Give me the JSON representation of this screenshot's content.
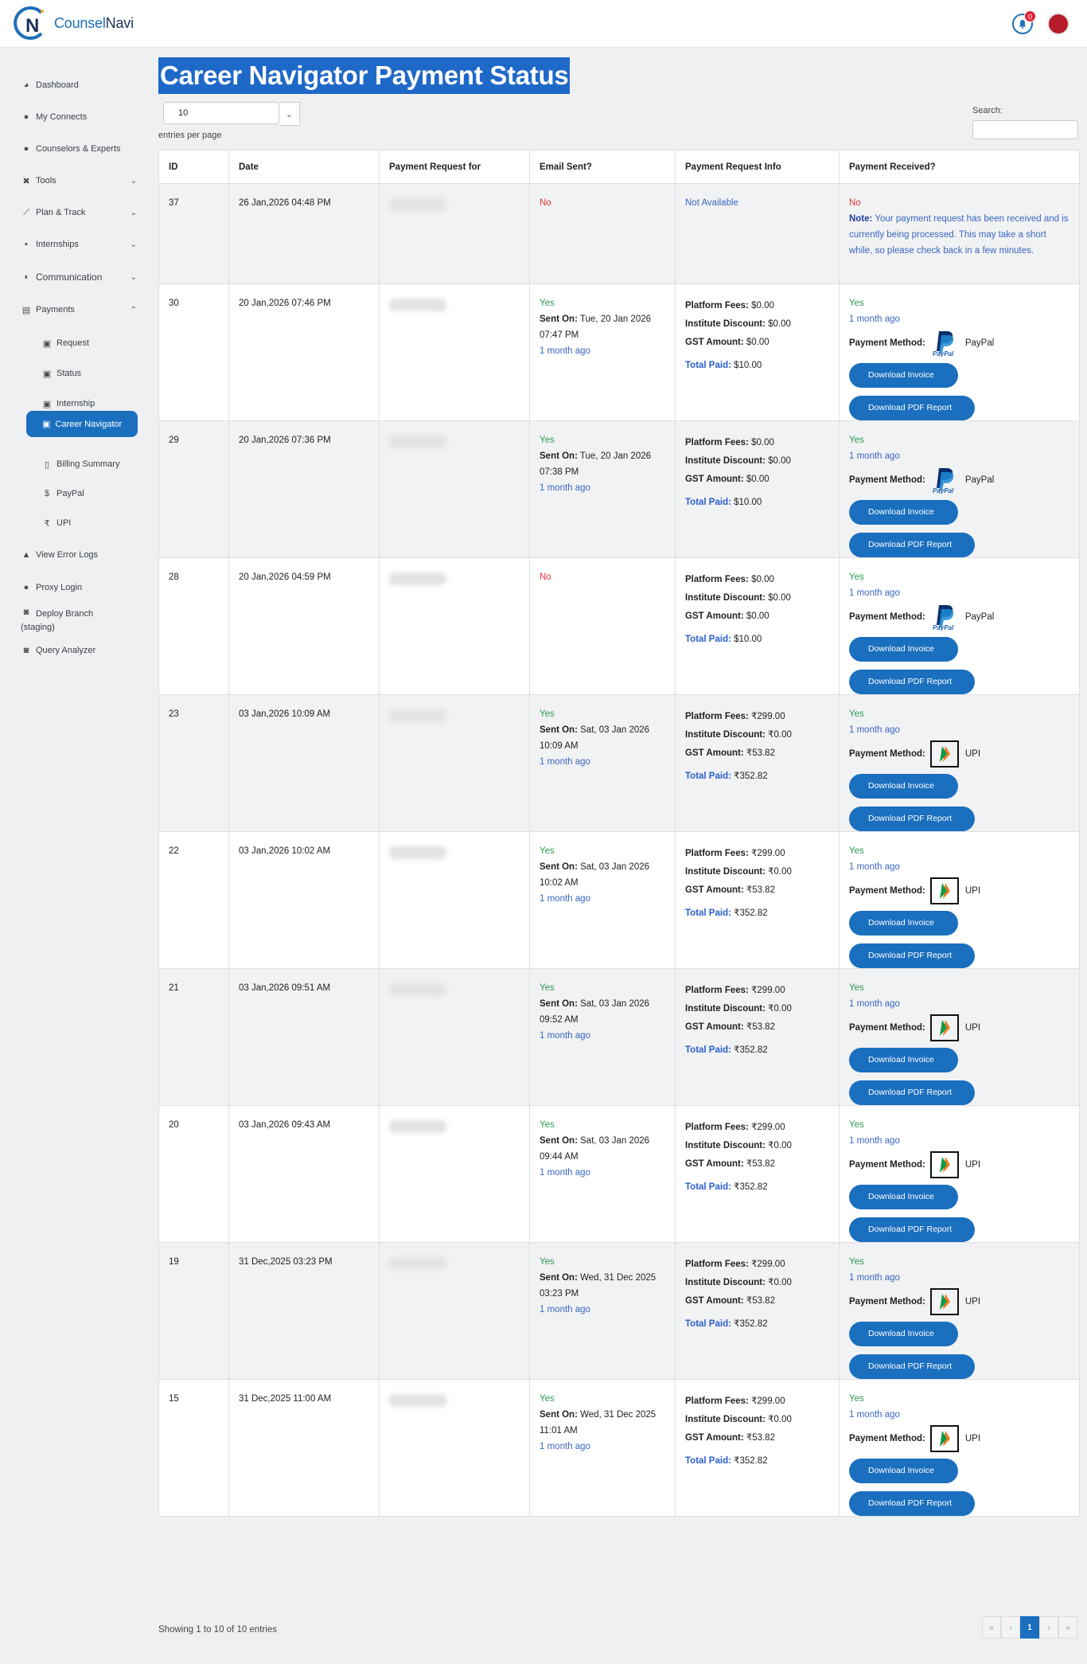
{
  "header": {
    "brand_part1": "Counsel",
    "brand_part2": "Navi",
    "notification_count": "0"
  },
  "sidebar": {
    "items": [
      {
        "label": "Dashboard",
        "icon": "dashboard-icon"
      },
      {
        "label": "My Connects",
        "icon": "user-icon"
      },
      {
        "label": "Counselors & Experts",
        "icon": "user-icon"
      },
      {
        "label": "Tools",
        "icon": "tools-icon"
      },
      {
        "label": "Plan & Track",
        "icon": "chart-icon"
      },
      {
        "label": "Internships",
        "icon": "briefcase-icon"
      },
      {
        "label": "Communication",
        "icon": "chat-icon"
      },
      {
        "label": "Payments",
        "icon": "wallet-icon"
      },
      {
        "label": "Request",
        "icon": "money-icon"
      },
      {
        "label": "Status",
        "icon": "money-icon"
      },
      {
        "label": "Internship",
        "icon": "money-icon"
      },
      {
        "label": "Career Navigator",
        "icon": "money-icon"
      },
      {
        "label": "Billing Summary",
        "icon": "document-icon"
      },
      {
        "label": "PayPal",
        "icon": "dollar-icon"
      },
      {
        "label": "UPI",
        "icon": "rupee-icon"
      },
      {
        "label": "View Error Logs",
        "icon": "warning-icon"
      },
      {
        "label": "Proxy Login",
        "icon": "user-icon"
      },
      {
        "label": "Deploy Branch",
        "sublabel": "(staging)",
        "icon": "database-icon"
      },
      {
        "label": "Query Analyzer",
        "icon": "database-icon"
      }
    ]
  },
  "page": {
    "title": "Career Navigator Payment Status",
    "page_length": "10",
    "entries_per_page": "entries per page",
    "search_label": "Search:",
    "search_placeholder": "",
    "showing": "Showing 1 to 10 of 10 entries",
    "pager": {
      "first": "«",
      "prev": "‹",
      "current": "1",
      "next": "›",
      "last": "»"
    }
  },
  "table": {
    "columns": [
      "ID",
      "Date",
      "Payment Request for",
      "Email Sent?",
      "Payment Request Info",
      "Payment Received?"
    ],
    "labels": {
      "sent_on": "Sent On:",
      "platform_fees": "Platform Fees:",
      "institute_discount": "Institute Discount:",
      "gst_amount": "GST Amount:",
      "total_paid": "Total Paid:",
      "payment_method": "Payment Method:",
      "download_invoice": "Download Invoice",
      "download_pdf": "Download PDF Report",
      "note_label": "Note:"
    },
    "rows": [
      {
        "id": "37",
        "date": "26 Jan,2026 04:48 PM",
        "email": "No",
        "info_na": "Not Available",
        "received": "No",
        "note": "Your payment request has been received and is currently being processed. This may take a short while, so please check back in a few minutes."
      },
      {
        "id": "30",
        "date": "20 Jan,2026 07:46 PM",
        "email": "Yes",
        "sent_on": "Tue, 20 Jan 2026 07:47 PM",
        "ago": "1 month ago",
        "platform_fees": "$0.00",
        "institute_discount": "$0.00",
        "gst": "$0.00",
        "total": "$10.00",
        "received": "Yes",
        "received_ago": "1 month ago",
        "method": "PayPal",
        "method_icon": "paypal-icon"
      },
      {
        "id": "29",
        "date": "20 Jan,2026 07:36 PM",
        "email": "Yes",
        "sent_on": "Tue, 20 Jan 2026 07:38 PM",
        "ago": "1 month ago",
        "platform_fees": "$0.00",
        "institute_discount": "$0.00",
        "gst": "$0.00",
        "total": "$10.00",
        "received": "Yes",
        "received_ago": "1 month ago",
        "method": "PayPal",
        "method_icon": "paypal-icon"
      },
      {
        "id": "28",
        "date": "20 Jan,2026 04:59 PM",
        "email": "No",
        "platform_fees": "$0.00",
        "institute_discount": "$0.00",
        "gst": "$0.00",
        "total": "$10.00",
        "received": "Yes",
        "received_ago": "1 month ago",
        "method": "PayPal",
        "method_icon": "paypal-icon"
      },
      {
        "id": "23",
        "date": "03 Jan,2026 10:09 AM",
        "email": "Yes",
        "sent_on": "Sat, 03 Jan 2026 10:09 AM",
        "ago": "1 month ago",
        "platform_fees": "₹299.00",
        "institute_discount": "₹0.00",
        "gst": "₹53.82",
        "total": "₹352.82",
        "received": "Yes",
        "received_ago": "1 month ago",
        "method": "UPI",
        "method_icon": "upi-icon"
      },
      {
        "id": "22",
        "date": "03 Jan,2026 10:02 AM",
        "email": "Yes",
        "sent_on": "Sat, 03 Jan 2026 10:02 AM",
        "ago": "1 month ago",
        "platform_fees": "₹299.00",
        "institute_discount": "₹0.00",
        "gst": "₹53.82",
        "total": "₹352.82",
        "received": "Yes",
        "received_ago": "1 month ago",
        "method": "UPI",
        "method_icon": "upi-icon"
      },
      {
        "id": "21",
        "date": "03 Jan,2026 09:51 AM",
        "email": "Yes",
        "sent_on": "Sat, 03 Jan 2026 09:52 AM",
        "ago": "1 month ago",
        "platform_fees": "₹299.00",
        "institute_discount": "₹0.00",
        "gst": "₹53.82",
        "total": "₹352.82",
        "received": "Yes",
        "received_ago": "1 month ago",
        "method": "UPI",
        "method_icon": "upi-icon"
      },
      {
        "id": "20",
        "date": "03 Jan,2026 09:43 AM",
        "email": "Yes",
        "sent_on": "Sat, 03 Jan 2026 09:44 AM",
        "ago": "1 month ago",
        "platform_fees": "₹299.00",
        "institute_discount": "₹0.00",
        "gst": "₹53.82",
        "total": "₹352.82",
        "received": "Yes",
        "received_ago": "1 month ago",
        "method": "UPI",
        "method_icon": "upi-icon"
      },
      {
        "id": "19",
        "date": "31 Dec,2025 03:23 PM",
        "email": "Yes",
        "sent_on": "Wed, 31 Dec 2025 03:23 PM",
        "ago": "1 month ago",
        "platform_fees": "₹299.00",
        "institute_discount": "₹0.00",
        "gst": "₹53.82",
        "total": "₹352.82",
        "received": "Yes",
        "received_ago": "1 month ago",
        "method": "UPI",
        "method_icon": "upi-icon"
      },
      {
        "id": "15",
        "date": "31 Dec,2025 11:00 AM",
        "email": "Yes",
        "sent_on": "Wed, 31 Dec 2025 11:01 AM",
        "ago": "1 month ago",
        "platform_fees": "₹299.00",
        "institute_discount": "₹0.00",
        "gst": "₹53.82",
        "total": "₹352.82",
        "received": "Yes",
        "received_ago": "1 month ago",
        "method": "UPI",
        "method_icon": "upi-icon"
      }
    ]
  },
  "colors": {
    "accent": "#1a6fbf",
    "yes": "#2c9a55",
    "no": "#e0343e",
    "link": "#3a66c2"
  }
}
